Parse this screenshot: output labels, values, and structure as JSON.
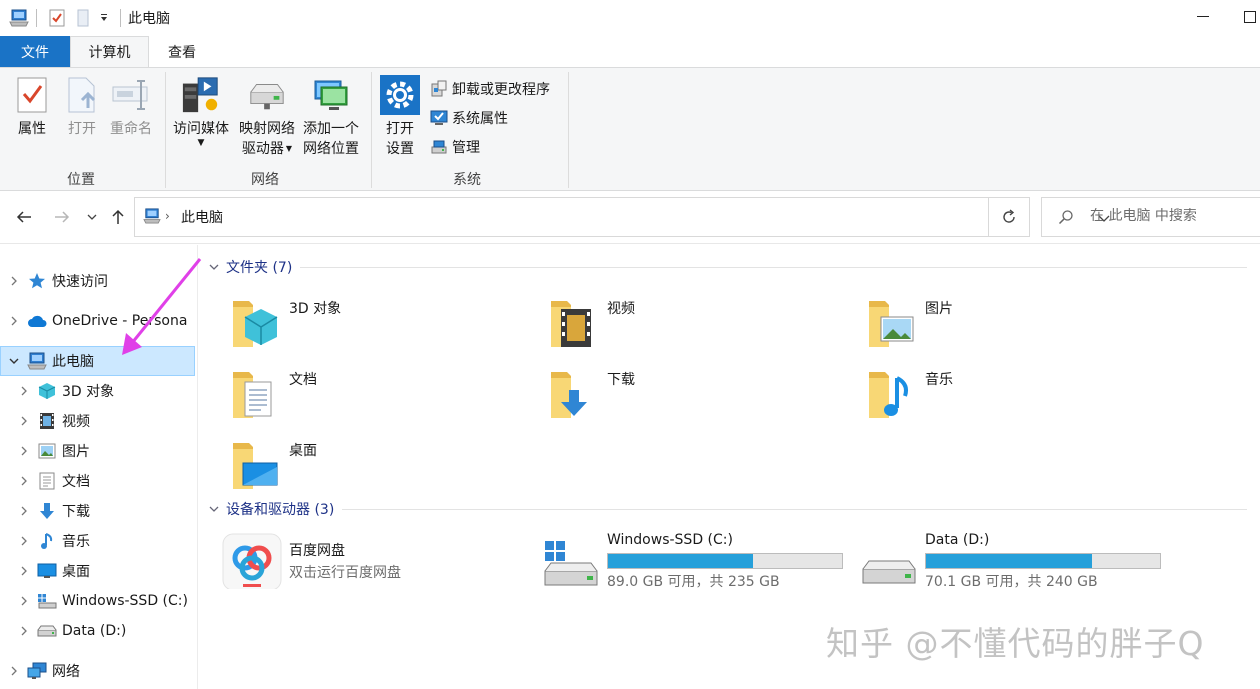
{
  "window": {
    "title": "此电脑"
  },
  "tabs": [
    {
      "label": "文件"
    },
    {
      "label": "计算机"
    },
    {
      "label": "查看"
    }
  ],
  "ribbon": {
    "location": {
      "label": "位置",
      "properties": "属性",
      "open": "打开",
      "rename": "重命名"
    },
    "network": {
      "label": "网络",
      "media_line1": "访问媒体",
      "map_line1": "映射网络",
      "map_line2": "驱动器",
      "add_line1": "添加一个",
      "add_line2": "网络位置"
    },
    "system": {
      "label": "系统",
      "settings_line1": "打开",
      "settings_line2": "设置",
      "uninstall": "卸载或更改程序",
      "sysprops": "系统属性",
      "manage": "管理"
    }
  },
  "address": {
    "path": "此电脑",
    "search_placeholder": "在 此电脑 中搜索"
  },
  "navpane": {
    "items": [
      {
        "label": "快速访问",
        "icon": "star-icon"
      },
      {
        "label": "OneDrive - Persona",
        "icon": "cloud-icon"
      },
      {
        "label": "此电脑",
        "icon": "computer-icon"
      },
      {
        "label": "3D 对象",
        "icon": "cube-icon"
      },
      {
        "label": "视频",
        "icon": "film-icon"
      },
      {
        "label": "图片",
        "icon": "picture-icon"
      },
      {
        "label": "文档",
        "icon": "document-icon"
      },
      {
        "label": "下载",
        "icon": "download-arrow-icon"
      },
      {
        "label": "音乐",
        "icon": "music-note-icon"
      },
      {
        "label": "桌面",
        "icon": "desktop-icon"
      },
      {
        "label": "Windows-SSD (C:)",
        "icon": "windows-drive-icon"
      },
      {
        "label": "Data (D:)",
        "icon": "drive-icon"
      },
      {
        "label": "网络",
        "icon": "network-icon"
      }
    ]
  },
  "content": {
    "folders_header": "文件夹 (7)",
    "folders": [
      {
        "name": "3D 对象",
        "icon": "cube-icon"
      },
      {
        "name": "视频",
        "icon": "film-icon"
      },
      {
        "name": "图片",
        "icon": "picture-icon"
      },
      {
        "name": "文档",
        "icon": "document-icon"
      },
      {
        "name": "下载",
        "icon": "download-arrow-icon"
      },
      {
        "name": "音乐",
        "icon": "music-note-icon"
      },
      {
        "name": "桌面",
        "icon": "desktop-icon"
      }
    ],
    "devices_header": "设备和驱动器 (3)",
    "devices": [
      {
        "name": "百度网盘",
        "subtitle": "双击运行百度网盘",
        "icon": "baidu-netdisk-icon"
      },
      {
        "name": "Windows-SSD (C:)",
        "subtitle": "89.0 GB 可用，共 235 GB",
        "used_fraction": 0.62,
        "icon": "windows-drive-icon"
      },
      {
        "name": "Data (D:)",
        "subtitle": "70.1 GB 可用，共 240 GB",
        "used_fraction": 0.71,
        "icon": "drive-icon"
      }
    ]
  },
  "watermark": "知乎 @不懂代码的胖子Q",
  "colors": {
    "accent": "#1a73c6",
    "selection": "#cce8ff",
    "bar_fill": "#26a0da",
    "folder": "#f8d775",
    "annotation_arrow": "#e040e8"
  }
}
